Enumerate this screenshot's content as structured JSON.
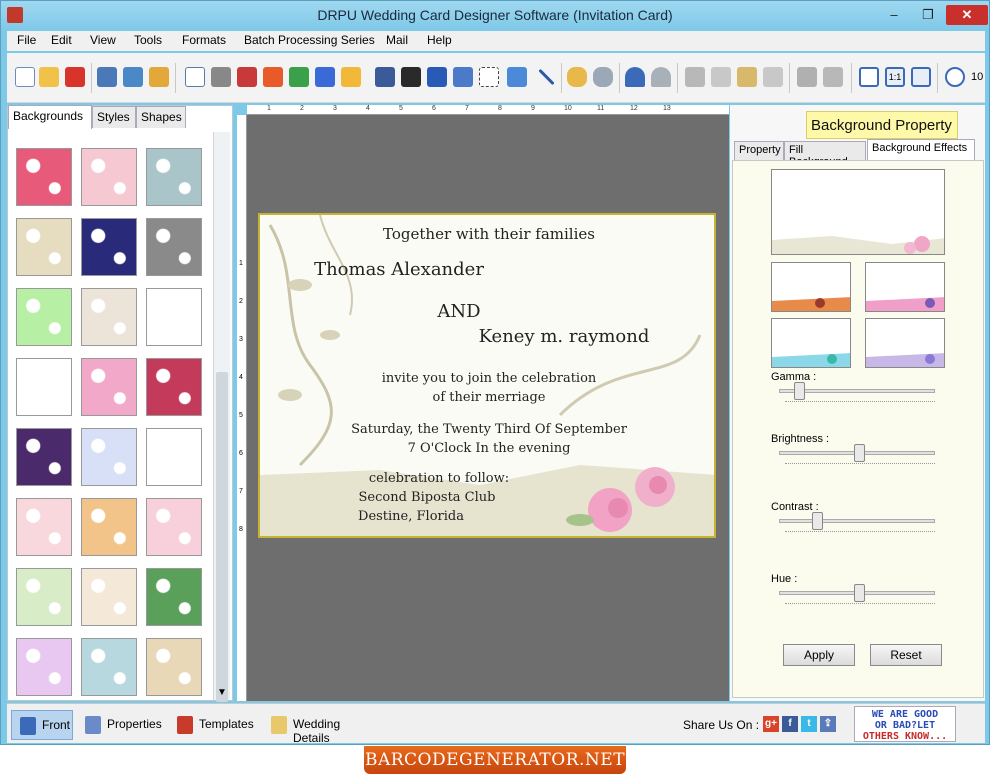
{
  "window": {
    "title": "DRPU Wedding Card Designer Software (Invitation Card)",
    "controls": {
      "minimize": "–",
      "maximize": "❐",
      "close": "✕"
    }
  },
  "menubar": [
    "File",
    "Edit",
    "View",
    "Tools",
    "Formats",
    "Batch Processing Series",
    "Mail",
    "Help"
  ],
  "toolbar": {
    "icons": [
      "new-icon",
      "open-icon",
      "close-doc-icon",
      "save-icon",
      "save-as-icon",
      "export-icon",
      "print-preview-icon",
      "print-icon",
      "print-batch-icon",
      "gift-icon",
      "image-icon",
      "pen-icon",
      "picture-icon",
      "barcode-icon",
      "barcode2-icon",
      "text-icon",
      "wordart-icon",
      "signature-icon",
      "mail-icon",
      "line-icon",
      "database-icon",
      "database2-icon",
      "undo-icon",
      "redo-icon",
      "copy-icon",
      "cut-icon",
      "paste-icon",
      "paste2-icon",
      "bring-front-icon",
      "send-back-icon",
      "grid-icon",
      "actual-size-icon",
      "fit-icon",
      "zoom-in-icon"
    ],
    "zoom_text": "10"
  },
  "left_panel": {
    "tabs": [
      "Backgrounds",
      "Styles",
      "Shapes"
    ],
    "active_tab": "Backgrounds",
    "thumbnail_colors": [
      [
        "#e85a7a",
        "#f6c9d2",
        "#a9c5c9"
      ],
      [
        "#e6dcc0",
        "#2a2a7a",
        "#8a8a8a"
      ],
      [
        "#b7f0a4",
        "#ece4d8",
        "#ffffff"
      ],
      [
        "#ffffff",
        "#f2a8c8",
        "#c43a5a"
      ],
      [
        "#4a2a6a",
        "#d8e0f8",
        "#ffffff"
      ],
      [
        "#f8d8dc",
        "#f2c48a",
        "#f8d0dc"
      ],
      [
        "#d8ecc8",
        "#f4e8d8",
        "#5aa05a"
      ],
      [
        "#e8c8f0",
        "#b8d8e0",
        "#e8d8b8"
      ]
    ]
  },
  "ruler": {
    "top_labels": [
      "1",
      "2",
      "3",
      "4",
      "5",
      "6",
      "7",
      "8",
      "9",
      "10",
      "11",
      "12",
      "13"
    ],
    "left_labels": [
      "1",
      "2",
      "3",
      "4",
      "5",
      "6",
      "7",
      "8"
    ]
  },
  "card": {
    "line1": "Together with their families",
    "groom": "Thomas Alexander",
    "and": "AND",
    "bride": "Keney m. raymond",
    "invite1": "invite you to join the celebration",
    "invite2": "of their merriage",
    "date": "Saturday, the Twenty Third Of September",
    "time": "7 O'Clock In the evening",
    "celebration": "celebration to follow:",
    "venue": "Second Biposta Club",
    "location": "Destine, Florida"
  },
  "right_panel": {
    "header": "Background Property",
    "tabs": [
      "Property",
      "Fill Background",
      "Background Effects"
    ],
    "active_tab": "Background Effects",
    "sliders": [
      {
        "label": "Gamma :",
        "value": 0.1
      },
      {
        "label": "Brightness :",
        "value": 0.5
      },
      {
        "label": "Contrast :",
        "value": 0.22
      },
      {
        "label": "Hue :",
        "value": 0.5
      }
    ],
    "apply_label": "Apply",
    "reset_label": "Reset"
  },
  "bottom_bar": {
    "items": [
      "Front",
      "Properties",
      "Templates",
      "Wedding Details"
    ],
    "active": "Front",
    "share_label": "Share Us On :",
    "feedback_lines": [
      "WE ARE GOOD",
      "OR BAD?LET",
      "OTHERS KNOW..."
    ]
  },
  "watermark": "BARCODEGENERATOR.NET"
}
